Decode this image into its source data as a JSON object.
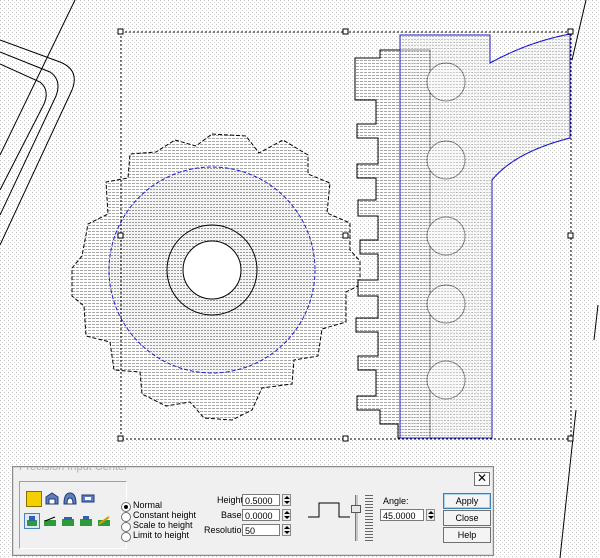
{
  "panel": {
    "title": "Precision Input Center",
    "close_glyph": "✕",
    "height_label": "Height:",
    "height_value": "0.5000",
    "base_label": "Base:",
    "base_value": "0.0000",
    "resolution_label": "Resolution:",
    "resolution_value": "50",
    "angle_label": "Angle:",
    "angle_value": "45.0000",
    "modes": [
      {
        "label": "Normal",
        "selected": true
      },
      {
        "label": "Constant height",
        "selected": false
      },
      {
        "label": "Scale to height",
        "selected": false
      },
      {
        "label": "Limit to height",
        "selected": false
      }
    ],
    "apply_label": "Apply",
    "close_label": "Close",
    "help_label": "Help"
  },
  "icons": {
    "row1": [
      "yellow-square-icon",
      "dome-bevel-icon",
      "dome-icon",
      "flat-bar-icon"
    ],
    "row2": [
      "carve-tool-a-icon",
      "carve-tool-b-icon",
      "carve-tool-c-icon",
      "carve-tool-d-icon",
      "carve-tool-e-icon"
    ]
  },
  "colors": {
    "selection_blue": "#1c1cd0",
    "hatch": "#9a9a9a",
    "panel_bg": "#f0f0f0",
    "accent_yellow": "#f5d000"
  }
}
